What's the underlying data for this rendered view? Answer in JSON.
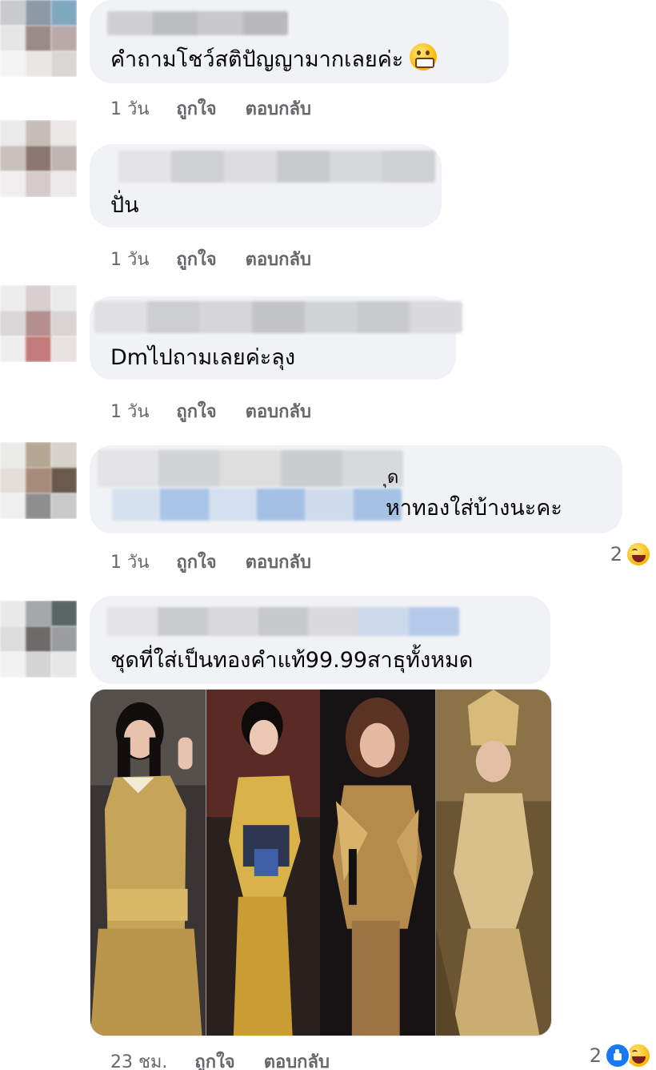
{
  "comments": [
    {
      "text": "คำถามโชว์สติปัญญามากเลยค่ะ",
      "time": "1 วัน",
      "like": "ถูกใจ",
      "reply": "ตอบกลับ"
    },
    {
      "text": "ปั่น",
      "time": "1 วัน",
      "like": "ถูกใจ",
      "reply": "ตอบกลับ"
    },
    {
      "text": "Dmไปถามเลยค่ะลุง",
      "time": "1 วัน",
      "like": "ถูกใจ",
      "reply": "ตอบกลับ"
    },
    {
      "text_line1": "ุด",
      "text_line2": "หาทองใส่บ้างนะคะ",
      "time": "1 วัน",
      "like": "ถูกใจ",
      "reply": "ตอบกลับ",
      "reaction_count": "2"
    },
    {
      "text": "ชุดที่ใส่เป็นทองคำแท้99.99สาธุทั้งหมด",
      "time": "23 ชม.",
      "like": "ถูกใจ",
      "reply": "ตอบกลับ",
      "reaction_count": "2"
    }
  ],
  "icons": {
    "grin": "grinning-emoji-icon",
    "haha": "haha-reaction-icon",
    "like": "like-reaction-icon"
  },
  "colors": {
    "bubble": "#f0f2f5",
    "meta_text": "#65676b",
    "like_blue": "#1877f2"
  }
}
